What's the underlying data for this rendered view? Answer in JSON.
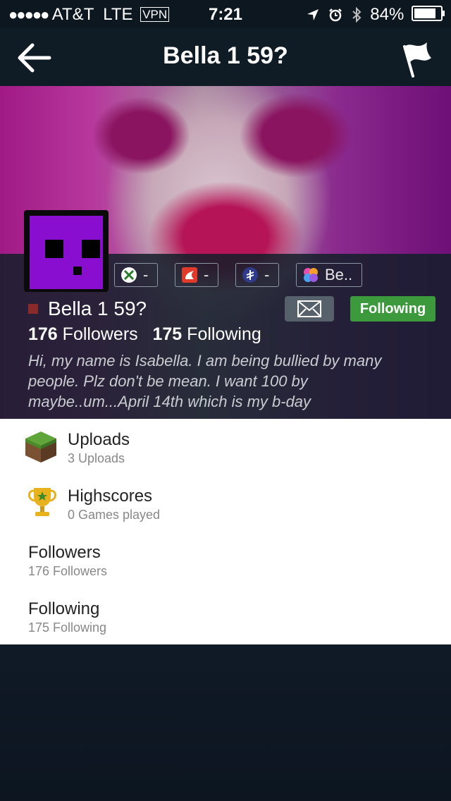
{
  "status_bar": {
    "signal": "●●●●●",
    "carrier": "AT&T",
    "network": "LTE",
    "vpn": "VPN",
    "time": "7:21",
    "battery": "84%"
  },
  "nav": {
    "title": "Bella 1 59?",
    "back_icon": "back-arrow-icon",
    "flag_icon": "flag-icon"
  },
  "profile": {
    "name": "Bella 1 59?",
    "services": [
      {
        "icon": "xbox-icon",
        "label": "-"
      },
      {
        "icon": "app-store-icon",
        "label": "-"
      },
      {
        "icon": "playstation-icon",
        "label": "-"
      },
      {
        "icon": "game-center-icon",
        "label": "Be.."
      }
    ],
    "follow_button": "Following",
    "followers_count": "176",
    "followers_label": "Followers",
    "following_count": "175",
    "following_label": "Following",
    "bio": "Hi, my name is Isabella. I am being bullied by many people. Plz don't be mean. I want 100 by maybe..um...April 14th which is my b-day"
  },
  "list": [
    {
      "title": "Uploads",
      "subtitle": "3 Uploads",
      "icon": "minecraft-block-icon"
    },
    {
      "title": "Highscores",
      "subtitle": "0 Games played",
      "icon": "trophy-icon"
    },
    {
      "title": "Followers",
      "subtitle": "176 Followers"
    },
    {
      "title": "Following",
      "subtitle": "175 Following"
    }
  ]
}
